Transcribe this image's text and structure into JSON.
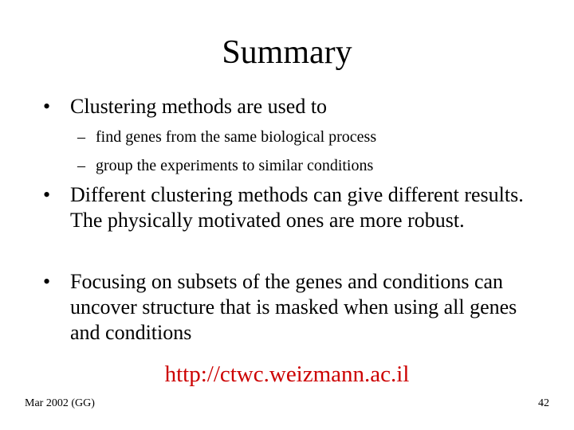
{
  "slide": {
    "title": "Summary",
    "bullets": [
      {
        "text": "Clustering methods are used to",
        "sub": [
          "find genes from the same biological process",
          "group the experiments to similar conditions"
        ]
      },
      {
        "text": "Different clustering methods can give different results. The physically motivated ones are more robust."
      },
      {
        "text": "Focusing on subsets of the genes and conditions can uncover structure that is masked when using all genes and conditions"
      }
    ],
    "bullet_glyph": "•",
    "dash_glyph": "–",
    "url": "http://ctwc.weizmann.ac.il",
    "url_color": "#cc0000",
    "footer_left": "Mar 2002 (GG)",
    "page_number": "42"
  }
}
